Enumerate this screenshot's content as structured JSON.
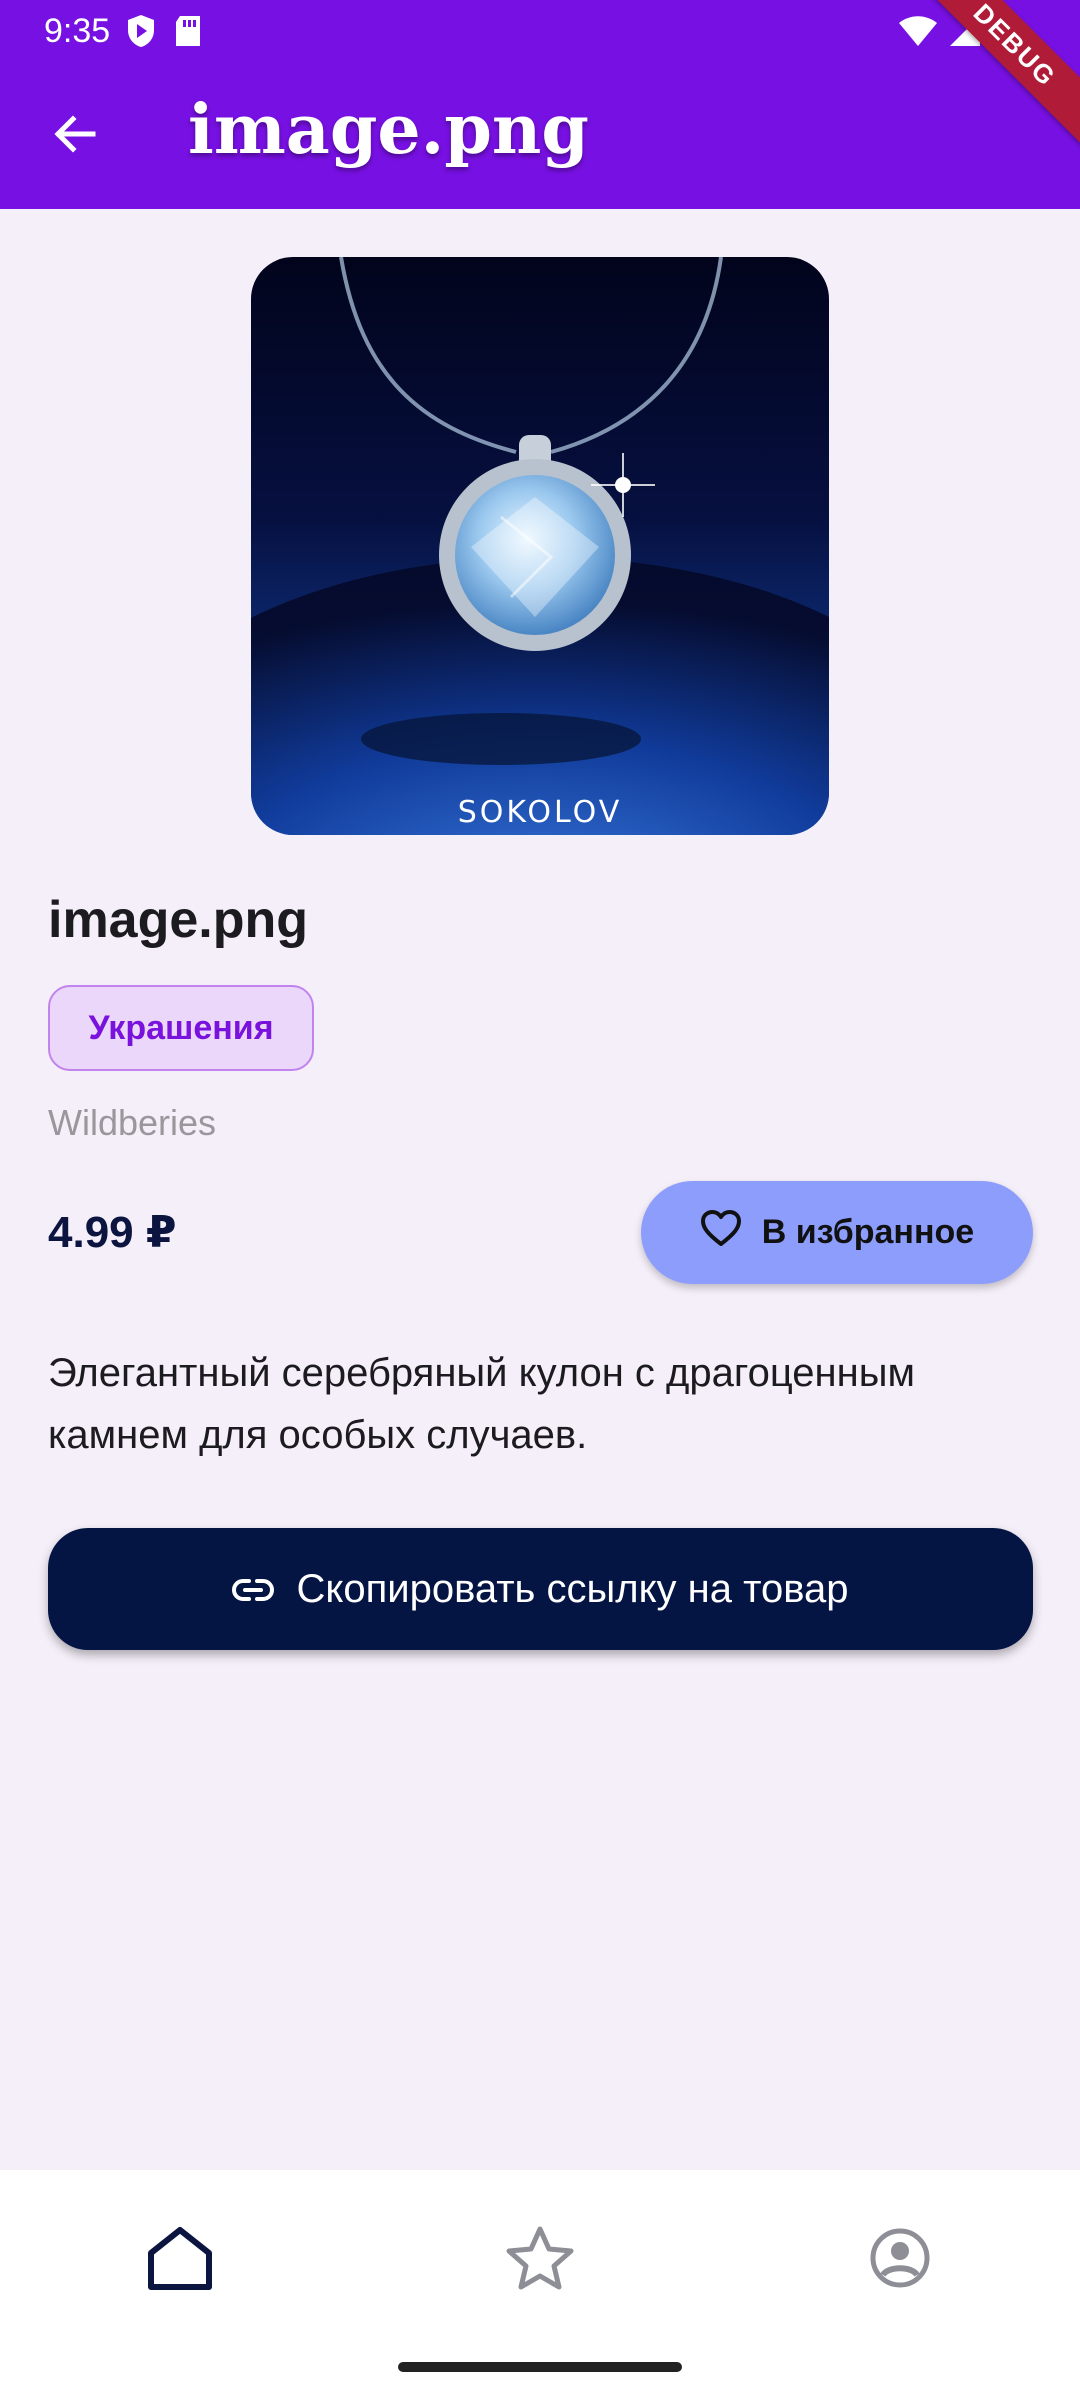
{
  "status_bar": {
    "time": "9:35",
    "icons": [
      "play-protect-icon",
      "sd-card-icon",
      "wifi-icon",
      "signal-icon",
      "battery-icon"
    ]
  },
  "debug_banner": "DEBUG",
  "app_bar": {
    "title": "image.png",
    "back_icon": "arrow-left-icon"
  },
  "product": {
    "image_alt": "Silver pendant with a blue gemstone",
    "image_brand_text": "SOKOLOV",
    "title": "image.png",
    "category": "Украшения",
    "seller": "Wildberies",
    "price": "4.99 ₽",
    "description": "Элегантный серебряный кулон с драгоценным камнем для особых случаев."
  },
  "actions": {
    "favorite_label": "В избранное",
    "favorite_icon": "heart-outline-icon",
    "copy_link_label": "Скопировать ссылку на товар",
    "copy_link_icon": "link-icon"
  },
  "bottom_nav": {
    "items": [
      {
        "icon": "home-icon",
        "active": true
      },
      {
        "icon": "star-outline-icon",
        "active": false
      },
      {
        "icon": "account-circle-icon",
        "active": false
      }
    ]
  },
  "colors": {
    "app_bar": "#7710e2",
    "background": "#f5eff9",
    "chip_bg": "#ead7f9",
    "chip_text": "#7a12dd",
    "favorite_button": "#8c9dfc",
    "primary_dark": "#041443",
    "debug_ribbon": "#b01c38"
  }
}
